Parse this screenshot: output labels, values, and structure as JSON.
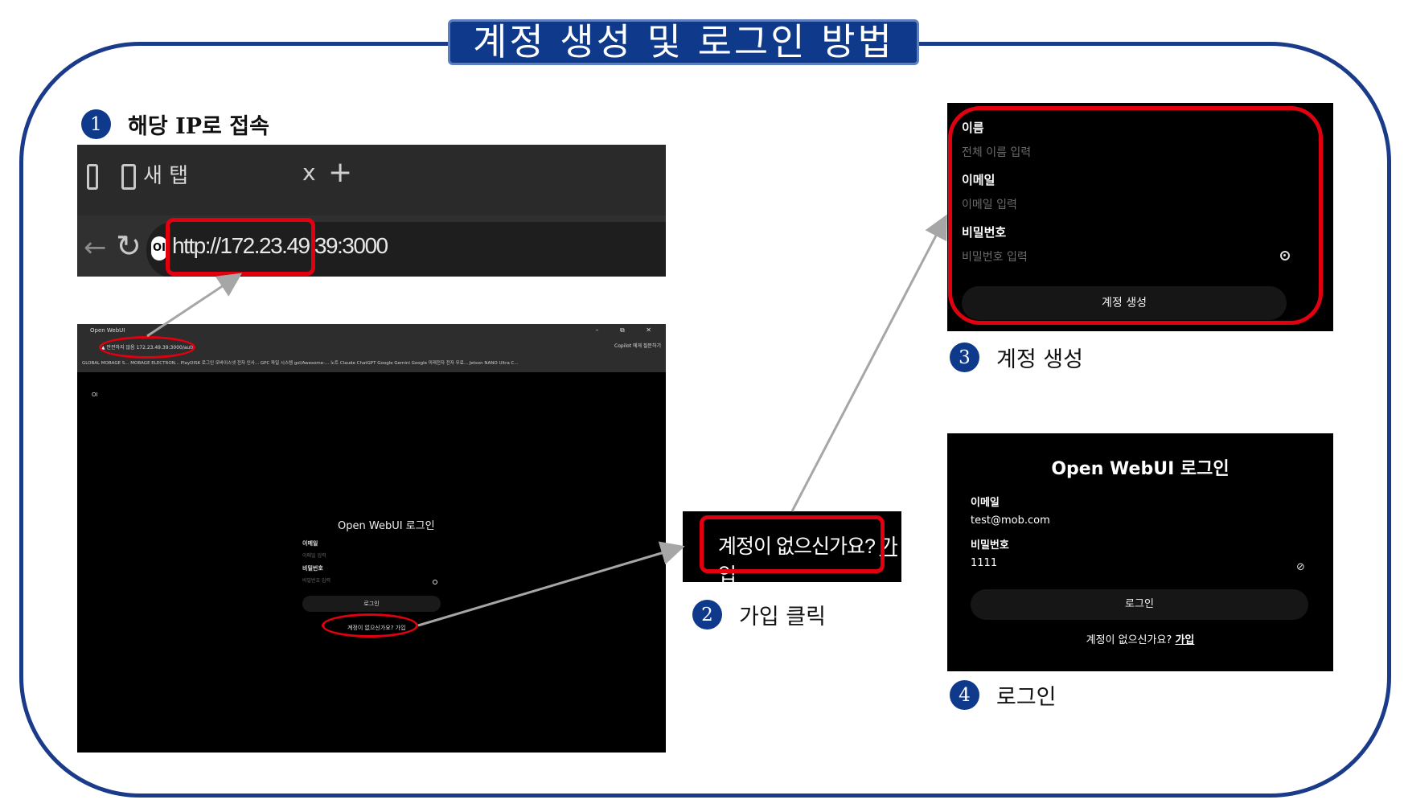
{
  "title": "계정 생성 및 로그인 방법",
  "steps": [
    {
      "num": "1",
      "text": "해당 IP로 접속"
    },
    {
      "num": "2",
      "text": "가입 클릭"
    },
    {
      "num": "3",
      "text": "계정 생성"
    },
    {
      "num": "4",
      "text": "로그인"
    }
  ],
  "browser": {
    "tab_title": "새 탭",
    "tab_close": "x",
    "tab_new": "+",
    "site_icon_label": "OI",
    "url": "http://172.23.49.39:3000"
  },
  "full_browser": {
    "tab_title": "Open WebUI",
    "window_controls": "– ⧉ ✕",
    "url": "▲ 안전하지 않음   172.23.49.39:3000/auth",
    "toolbar_right": "Copilot 에게 질문하기",
    "bookmarks": "GLOBAL MOBAGE S...  MOBAGE ELECTRON...  PlayDISK  로그인  모바이스넷 전자 인사...  GPC 파일 시스템  gsl/Awesome-...  노트  Claude  ChatGPT  Google Gemini  Google  미래전자 전자 무료...  Jetson NANO Ultra C...",
    "logo": "OI",
    "login_title": "Open WebUI 로그인",
    "email_label": "이메일",
    "email_placeholder": "이메일 입력",
    "password_label": "비밀번호",
    "password_placeholder": "비밀번호 입력",
    "login_button": "로그인",
    "signup_text": "계정이 없으신가요? 가입"
  },
  "signup_crop": {
    "prefix": "계정이 없으신가요? ",
    "link": "가입"
  },
  "create_panel": {
    "name_label": "이름",
    "name_placeholder": "전체 이름 입력",
    "email_label": "이메일",
    "email_placeholder": "이메일 입력",
    "password_label": "비밀번호",
    "password_placeholder": "비밀번호 입력",
    "submit_button": "계정 생성"
  },
  "login_panel": {
    "title": "Open WebUI 로그인",
    "email_label": "이메일",
    "email_value": "test@mob.com",
    "password_label": "비밀번호",
    "password_value": "1111",
    "login_button": "로그인",
    "signup_prefix": "계정이 없으신가요? ",
    "signup_link": "가입"
  },
  "colors": {
    "frame": "#1a3a8a",
    "title_bg": "#0f3a8c",
    "highlight": "#e1000f",
    "arrow": "#a6a6a6"
  }
}
